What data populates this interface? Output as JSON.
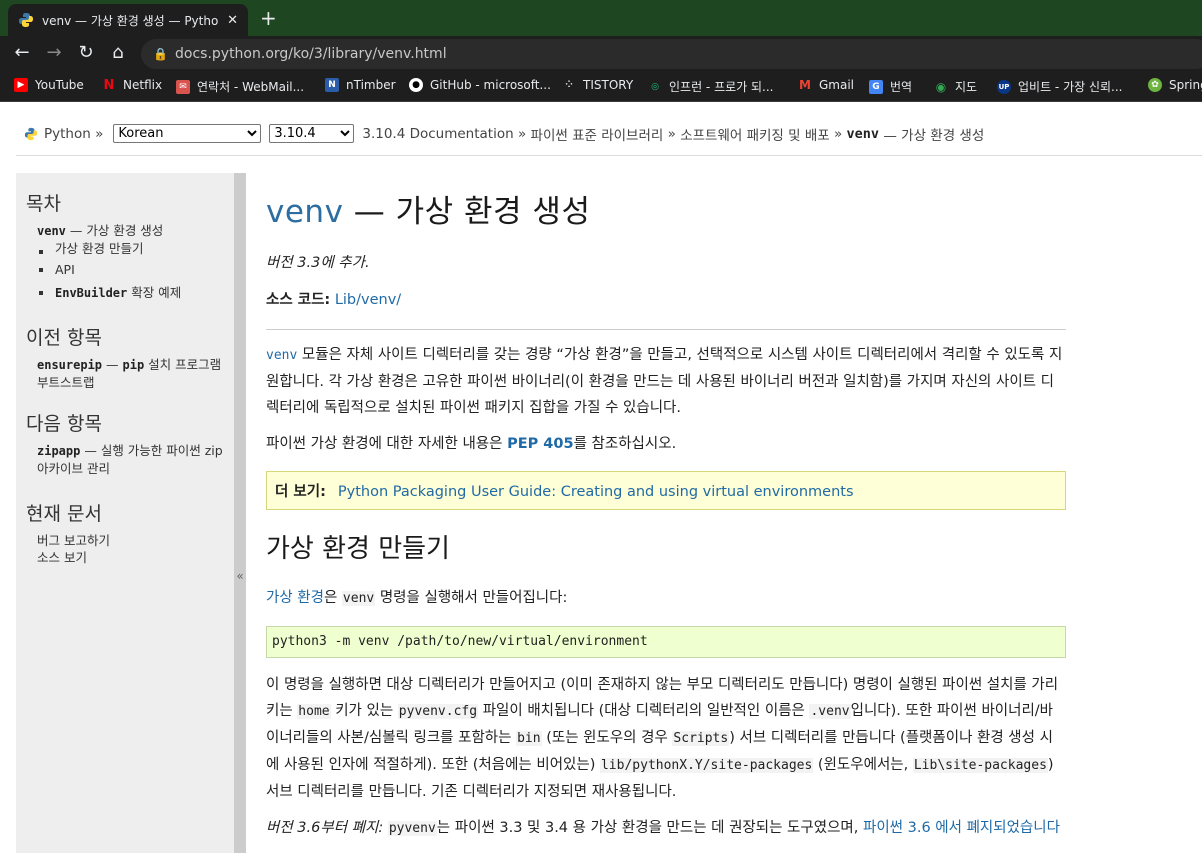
{
  "browser": {
    "tab_title": "venv — 가상 환경 생성 — Pytho",
    "tab_close": "✕",
    "new_tab": "+",
    "url": "docs.python.org/ko/3/library/venv.html",
    "bookmarks": [
      {
        "label": "YouTube",
        "icon": "youtube-icon",
        "color": "#ff0000"
      },
      {
        "label": "Netflix",
        "icon": "netflix-icon",
        "color": "#e50914"
      },
      {
        "label": "연락처 - WebMail...",
        "icon": "mail-icon",
        "color": "#d9534f"
      },
      {
        "label": "nTimber",
        "icon": "ntimber-icon",
        "color": "#2a5caa"
      },
      {
        "label": "GitHub - microsoft...",
        "icon": "github-icon",
        "color": "#ffffff"
      },
      {
        "label": "TISTORY",
        "icon": "tistory-icon",
        "color": "#ffffff"
      },
      {
        "label": "인프런 - 프로가 되...",
        "icon": "inflearn-icon",
        "color": "#1dc078"
      },
      {
        "label": "Gmail",
        "icon": "gmail-icon",
        "color": "#ea4335"
      },
      {
        "label": "번역",
        "icon": "translate-icon",
        "color": "#4285f4"
      },
      {
        "label": "지도",
        "icon": "maps-icon",
        "color": "#34a853"
      },
      {
        "label": "업비트 - 가장 신뢰...",
        "icon": "upbit-icon",
        "color": "#093687"
      },
      {
        "label": "Spring",
        "icon": "spring-icon",
        "color": "#6db33f"
      }
    ]
  },
  "header": {
    "python_label": "Python »",
    "language": "Korean",
    "version": "3.10.4",
    "crumb1": "3.10.4 Documentation",
    "sep": "»",
    "crumb2": "파이썬 표준 라이브러리",
    "crumb3": "소프트웨어 패키징 및 배포",
    "crumb4_code": "venv",
    "crumb4_rest": "— 가상 환경 생성"
  },
  "sidebar": {
    "toc_title": "목차",
    "toc_main_code": "venv",
    "toc_main_rest": "— 가상 환경 생성",
    "toc_items": [
      "가상 환경 만들기",
      "API"
    ],
    "toc_item3_code": "EnvBuilder",
    "toc_item3_rest": "확장 예제",
    "prev_title": "이전 항목",
    "prev_code": "ensurepip",
    "prev_mid": "—",
    "prev_code2": "pip",
    "prev_rest": "설치 프로그램 부트스트랩",
    "next_title": "다음 항목",
    "next_code": "zipapp",
    "next_rest": "— 실행 가능한 파이썬 zip 아카이브 관리",
    "this_page_title": "현재 문서",
    "report_bug": "버그 보고하기",
    "show_source": "소스 보기",
    "collapse": "«"
  },
  "content": {
    "title_module": "venv",
    "title_rest": "— 가상 환경 생성",
    "added": "버전 3.3에 추가.",
    "source_label": "소스 코드:",
    "source_link": "Lib/venv/",
    "p1_code": "venv",
    "p1_text": "모듈은 자체 사이트 디렉터리를 갖는 경량 “가상 환경”을 만들고, 선택적으로 시스템 사이트 디렉터리에서 격리할 수 있도록 지원합니다. 각 가상 환경은 고유한 파이썬 바이너리(이 환경을 만드는 데 사용된 바이너리 버전과 일치함)를 가지며 자신의 사이트 디렉터리에 독립적으로 설치된 파이썬 패키지 집합을 가질 수 있습니다.",
    "p2_pre": "파이썬 가상 환경에 대한 자세한 내용은",
    "p2_link": "PEP 405",
    "p2_post": "를 참조하십시오.",
    "seealso_label": "더 보기:",
    "seealso_link": "Python Packaging User Guide: Creating and using virtual environments",
    "h2": "가상 환경 만들기",
    "p3_link": "가상 환경",
    "p3_mid": "은",
    "p3_code": "venv",
    "p3_post": "명령을 실행해서 만들어집니다:",
    "command": "python3 -m venv /path/to/new/virtual/environment",
    "p4_a": "이 명령을 실행하면 대상 디렉터리가 만들어지고 (이미 존재하지 않는 부모 디렉터리도 만듭니다) 명령이 실행된 파이썬 설치를 가리키는",
    "p4_c1": "home",
    "p4_b": "키가 있는",
    "p4_c2": "pyvenv.cfg",
    "p4_c": "파일이 배치됩니다 (대상 디렉터리의 일반적인 이름은",
    "p4_c3": ".venv",
    "p4_d": "입니다). 또한 파이썬 바이너리/바이너리들의 사본/심볼릭 링크를 포함하는",
    "p4_c4": "bin",
    "p4_e": "(또는 윈도우의 경우",
    "p4_c5": "Scripts",
    "p4_f": ") 서브 디렉터리를 만듭니다 (플랫폼이나 환경 생성 시에 사용된 인자에 적절하게). 또한 (처음에는 비어있는)",
    "p4_c6": "lib/pythonX.Y/site-packages",
    "p4_g": "(윈도우에서는,",
    "p4_c7": "Lib\\site-packages",
    "p4_h": ") 서브 디렉터리를 만듭니다. 기존 디렉터리가 지정되면 재사용됩니다.",
    "p5_italic": "버전 3.6부터 폐지:",
    "p5_code": "pyvenv",
    "p5_text": "는 파이썬 3.3 및 3.4 용 가상 환경을 만드는 데 권장되는 도구였으며,",
    "p5_link": "파이썬 3.6 에서 폐지되었습니다"
  }
}
